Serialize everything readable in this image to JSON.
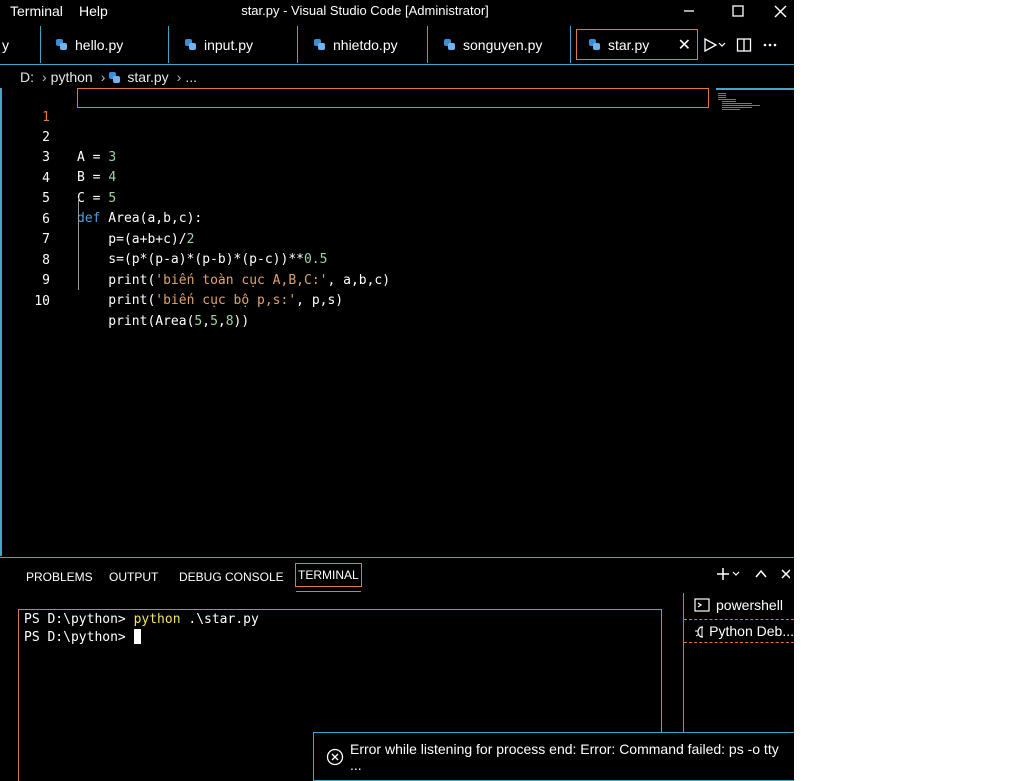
{
  "menu": {
    "terminal": "Terminal",
    "help": "Help"
  },
  "window": {
    "title": "star.py - Visual Studio Code [Administrator]"
  },
  "tabs": [
    {
      "label": "y",
      "file": "partial"
    },
    {
      "label": "hello.py"
    },
    {
      "label": "input.py"
    },
    {
      "label": "nhietdo.py"
    },
    {
      "label": "songuyen.py"
    },
    {
      "label": "star.py",
      "active": true
    }
  ],
  "breadcrumb": {
    "drive": "D:",
    "folder": "python",
    "file": "star.py",
    "more": "..."
  },
  "editor": {
    "lines": [
      {
        "n": "1",
        "text": ""
      },
      {
        "n": "2",
        "text": "A = 3"
      },
      {
        "n": "3",
        "text": "B = 4"
      },
      {
        "n": "4",
        "text": "C = 5"
      },
      {
        "n": "5",
        "text": "def Area(a,b,c):"
      },
      {
        "n": "6",
        "text": "    p=(a+b+c)/2"
      },
      {
        "n": "7",
        "text": "    s=(p*(p-a)*(p-b)*(p-c))**0.5"
      },
      {
        "n": "8",
        "text": "    print('biến toàn cục A,B,C:', a,b,c)"
      },
      {
        "n": "9",
        "text": "    print('biến cục bộ p,s:', p,s)"
      },
      {
        "n": "10",
        "text": "    print(Area(5,5,8))"
      }
    ]
  },
  "panel": {
    "tabs": [
      "PROBLEMS",
      "OUTPUT",
      "DEBUG CONSOLE",
      "TERMINAL"
    ],
    "active_tab": "TERMINAL",
    "terminal": {
      "line1_prompt": "PS D:\\python> ",
      "line1_cmd": "python",
      "line1_args": " .\\star.py",
      "line2_prompt": "PS D:\\python> "
    },
    "terminals": [
      "powershell",
      "Python Deb..."
    ]
  },
  "notification": {
    "text": "Error while listening for process end: Error: Command failed: ps -o tty ..."
  },
  "colors": {
    "accent": "#3fa7c8",
    "focus": "#e07a3b",
    "keyword": "#4f9fe0",
    "number": "#9ed3a5",
    "string": "#e0a36b"
  }
}
